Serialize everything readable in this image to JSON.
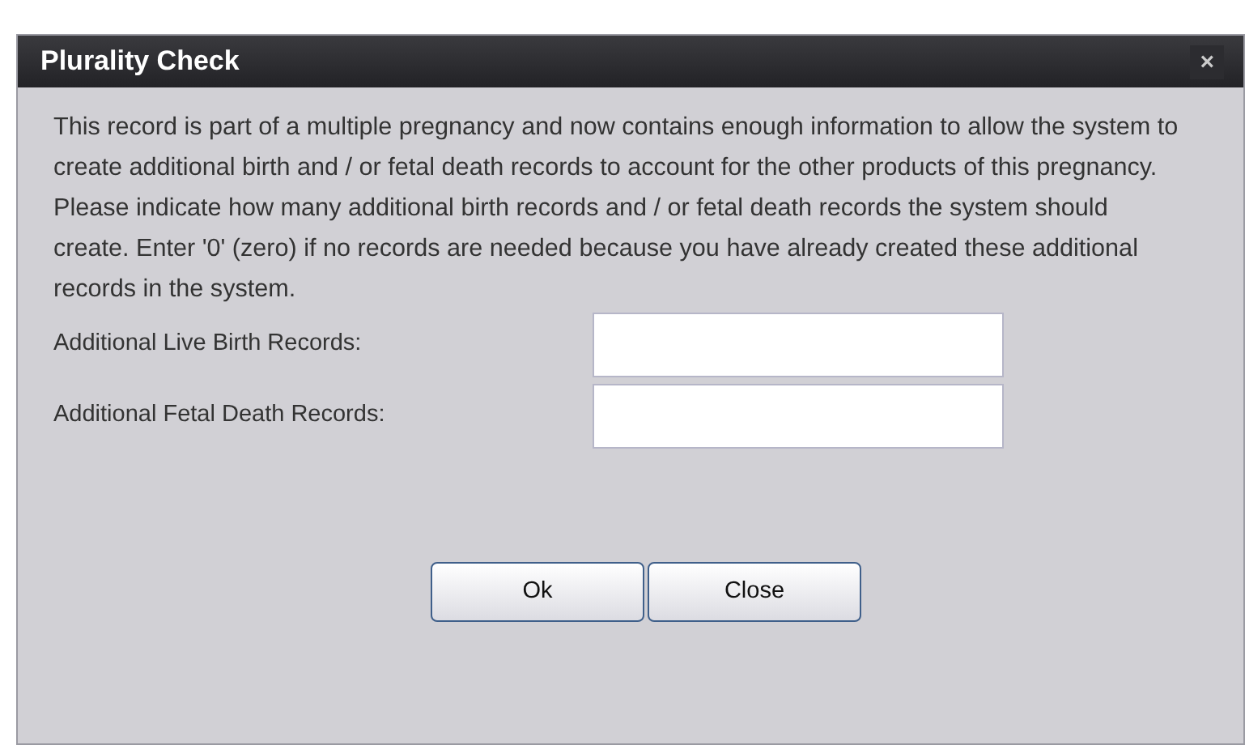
{
  "dialog": {
    "title": "Plurality Check",
    "close_glyph": "×",
    "message": "This record is part of a multiple pregnancy and now contains enough information to allow the system to create additional birth and / or fetal death records to account for the other products of this pregnancy. Please indicate how many additional birth records and / or fetal death records the system should create. Enter '0' (zero) if no records are needed because you have already created these additional records in the system.",
    "fields": [
      {
        "label": "Additional Live Birth Records:"
      },
      {
        "label": "Additional Fetal Death Records:"
      }
    ],
    "buttons": [
      "Ok",
      "Close"
    ]
  }
}
